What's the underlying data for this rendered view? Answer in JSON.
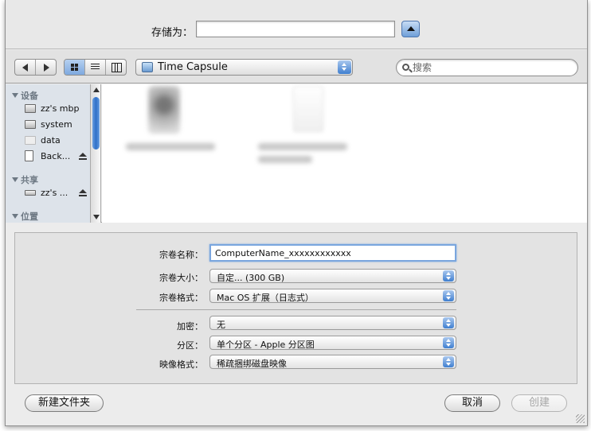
{
  "save_sheet": {
    "save_as_label": "存储为：",
    "filename_value": ""
  },
  "toolbar": {
    "back_icon": "back-arrow-icon",
    "forward_icon": "forward-arrow-icon",
    "view_modes": [
      "icon-view",
      "list-view",
      "column-view"
    ],
    "active_view": "icon-view",
    "location": "Time Capsule",
    "search_placeholder": "搜索"
  },
  "sidebar": {
    "devices_heading": "设备",
    "devices": [
      {
        "label": "zz's mbp",
        "icon": "laptop-icon",
        "eject": false
      },
      {
        "label": "system",
        "icon": "hard-disk-icon",
        "eject": false
      },
      {
        "label": "data",
        "icon": "hard-disk-icon",
        "eject": false
      },
      {
        "label": "Back...",
        "icon": "document-icon",
        "eject": true
      }
    ],
    "shared_heading": "共享",
    "shared": [
      {
        "label": "zz's ...",
        "icon": "network-drive-icon",
        "eject": true
      }
    ],
    "places_heading": "位置"
  },
  "options": {
    "volume_name_label": "宗卷名称：",
    "volume_name_value": "ComputerName_xxxxxxxxxxxx",
    "volume_size_label": "宗卷大小：",
    "volume_size_value": "自定... (300 GB)",
    "volume_format_label": "宗卷格式：",
    "volume_format_value": "Mac OS 扩展（日志式）",
    "encryption_label": "加密：",
    "encryption_value": "无",
    "partitions_label": "分区：",
    "partitions_value": "单个分区 - Apple 分区图",
    "image_format_label": "映像格式：",
    "image_format_value": "稀疏捆绑磁盘映像"
  },
  "footer": {
    "new_folder_label": "新建文件夹",
    "cancel_label": "取消",
    "create_label": "创建"
  },
  "colors": {
    "accent": "#3f7fd0",
    "sidebar_bg": "#dde3ea",
    "dialog_bg": "#ececec"
  }
}
